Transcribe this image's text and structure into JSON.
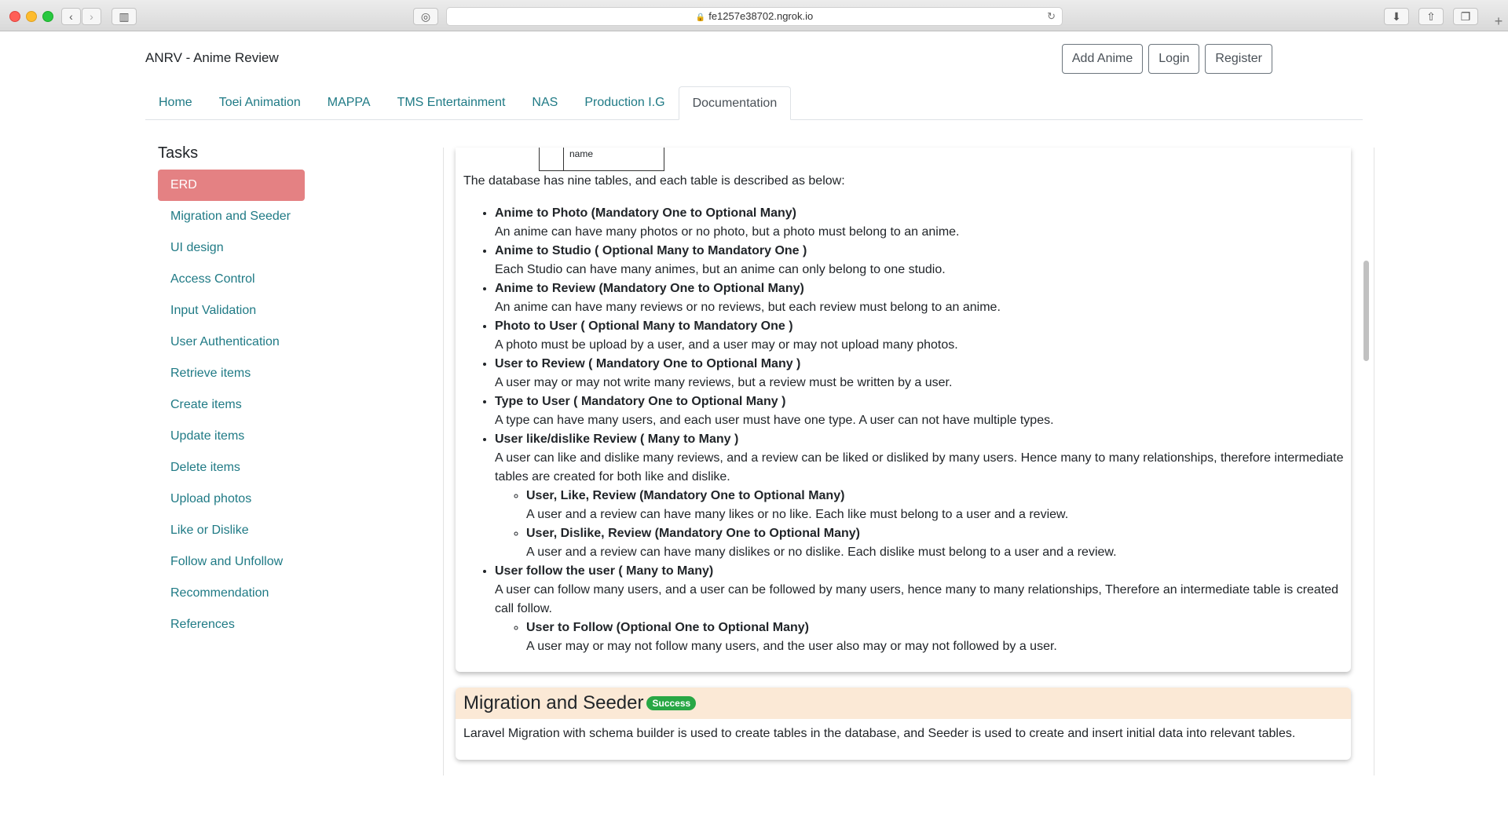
{
  "browser": {
    "url": "fe1257e38702.ngrok.io"
  },
  "site": {
    "brand": "ANRV - Anime Review"
  },
  "auth": [
    "Add Anime",
    "Login",
    "Register"
  ],
  "nav": [
    "Home",
    "Toei Animation",
    "MAPPA",
    "TMS Entertainment",
    "NAS",
    "Production I.G",
    "Documentation"
  ],
  "sidebar": {
    "title": "Tasks",
    "items": [
      "ERD",
      "Migration and Seeder",
      "UI design",
      "Access Control",
      "Input Validation",
      "User Authentication",
      "Retrieve items",
      "Create items",
      "Update items",
      "Delete items",
      "Upload photos",
      "Like or Dislike",
      "Follow and Unfollow",
      "Recommendation",
      "References"
    ]
  },
  "erd": {
    "box_label": "name",
    "intro": "The database has nine tables, and each table is described as below:",
    "relations": [
      {
        "title": "Anime to Photo (Mandatory One to Optional Many)",
        "desc": "An anime can have many photos or no photo, but a photo must belong to an anime."
      },
      {
        "title": "Anime to Studio ( Optional Many to Mandatory One )",
        "desc": "Each Studio can have many animes, but an anime can only belong to one studio."
      },
      {
        "title": "Anime to Review (Mandatory One to Optional Many)",
        "desc": "An anime can have many reviews or no reviews, but each review must belong to an anime."
      },
      {
        "title": "Photo to User ( Optional Many to Mandatory One )",
        "desc": "A photo must be upload by a user, and a user may or may not upload many photos."
      },
      {
        "title": "User to Review ( Mandatory One to Optional Many )",
        "desc": "A user may or may not write many reviews, but a review must be written by a user."
      },
      {
        "title": "Type to User ( Mandatory One to Optional Many )",
        "desc": "A type can have many users, and each user must have one type. A user can not have multiple types."
      },
      {
        "title": "User like/dislike Review ( Many to Many )",
        "desc": "A user can like and dislike many reviews, and a review can be liked or disliked by many users. Hence many to many relationships, therefore intermediate tables are created for both like and dislike."
      },
      {
        "title": "User, Like, Review (Mandatory One to Optional Many)",
        "desc": "A user and a review can have many likes or no like. Each like must belong to a user and a review."
      },
      {
        "title": "User, Dislike, Review (Mandatory One to Optional Many)",
        "desc": "A user and a review can have many dislikes or no dislike. Each dislike must belong to a user and a review."
      },
      {
        "title": "User follow the user ( Many to Many)",
        "desc": "A user can follow many users, and a user can be followed by many users, hence many to many relationships, Therefore an intermediate table is created call follow."
      },
      {
        "title": "User to Follow (Optional One to Optional Many)",
        "desc": "A user may or may not follow many users, and the user also may or may not followed by a user."
      }
    ]
  },
  "migration": {
    "title": "Migration and Seeder",
    "badge": "Success",
    "text": "Laravel Migration with schema builder is used to create tables in the database, and Seeder is used to create and insert initial data into relevant tables."
  }
}
